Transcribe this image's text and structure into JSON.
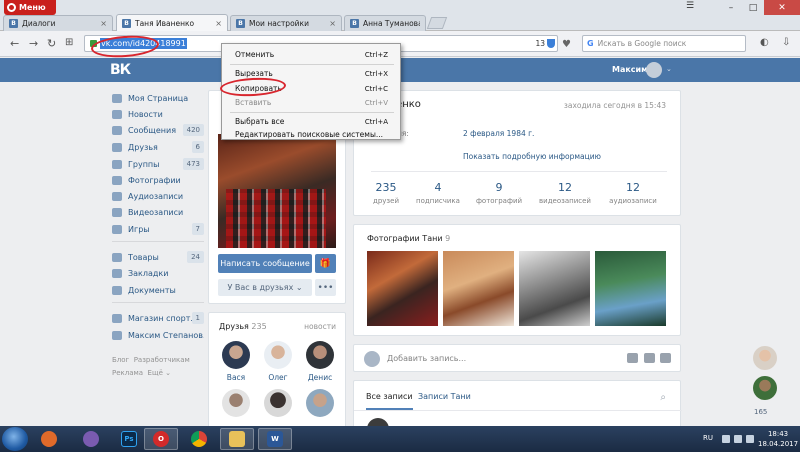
{
  "browser": {
    "menu_label": "Меню",
    "tabs": [
      {
        "title": "Диалоги",
        "active": false
      },
      {
        "title": "Таня Иваненко",
        "active": true
      },
      {
        "title": "Мои настройки",
        "active": false
      },
      {
        "title": "Анна Туманова",
        "active": false
      }
    ],
    "url": "vk.com/id420418991",
    "url_counter": "13",
    "search_placeholder": "Искать в Google поиск"
  },
  "header": {
    "logo": "ВК",
    "user_name": "Максим"
  },
  "sidebar": {
    "items": [
      {
        "label": "Моя Страница",
        "badge": ""
      },
      {
        "label": "Новости",
        "badge": ""
      },
      {
        "label": "Сообщения",
        "badge": "420"
      },
      {
        "label": "Друзья",
        "badge": "6"
      },
      {
        "label": "Группы",
        "badge": "473"
      },
      {
        "label": "Фотографии",
        "badge": ""
      },
      {
        "label": "Аудиозаписи",
        "badge": ""
      },
      {
        "label": "Видеозаписи",
        "badge": ""
      },
      {
        "label": "Игры",
        "badge": "7"
      },
      {
        "label": "Товары",
        "badge": "24"
      },
      {
        "label": "Закладки",
        "badge": ""
      },
      {
        "label": "Документы",
        "badge": ""
      },
      {
        "label": "Магазин спорт...",
        "badge": "1"
      },
      {
        "label": "Максим Степанов...",
        "badge": ""
      }
    ],
    "footer": {
      "blog": "Блог",
      "developers": "Разработчикам",
      "ads": "Реклама",
      "more": "Ещё ⌄"
    }
  },
  "profile": {
    "name": "иваненко",
    "last_seen": "заходила сегодня в 15:43",
    "birthday_label": "ождения:",
    "birthday": "2 февраля 1984 г.",
    "more_info": "Показать подробную информацию",
    "stats": [
      {
        "n": "235",
        "label": "друзей"
      },
      {
        "n": "4",
        "label": "подписчика"
      },
      {
        "n": "9",
        "label": "фотографий"
      },
      {
        "n": "12",
        "label": "видеозаписей"
      },
      {
        "n": "12",
        "label": "аудиозаписи"
      }
    ],
    "message_button": "Написать сообщение",
    "friends_button": "У Вас в друзьях ⌄",
    "more_button": "•••"
  },
  "friends": {
    "title": "Друзья",
    "count": "235",
    "all": "новости",
    "people": [
      "Вася",
      "Олег",
      "Денис"
    ]
  },
  "photos": {
    "title": "Фотографии Тани",
    "count": "9"
  },
  "post": {
    "placeholder": "Добавить запись..."
  },
  "wall": {
    "tab_all": "Все записи",
    "tab_user": "Записи Тани"
  },
  "chat": {
    "count": "165"
  },
  "context_menu": {
    "items": [
      {
        "label": "Отменить",
        "shortcut": "Ctrl+Z",
        "disabled": false
      },
      {
        "label": "Вырезать",
        "shortcut": "Ctrl+X",
        "disabled": false
      },
      {
        "label": "Копировать",
        "shortcut": "Ctrl+C",
        "disabled": false
      },
      {
        "label": "Вставить",
        "shortcut": "Ctrl+V",
        "disabled": true
      },
      {
        "label": "Выбрать все",
        "shortcut": "Ctrl+A",
        "disabled": false
      },
      {
        "label": "Редактировать поисковые системы...",
        "shortcut": "",
        "disabled": false
      }
    ]
  },
  "taskbar": {
    "lang": "RU",
    "time": "18:43",
    "date": "18.04.2017",
    "apps": [
      "Ps",
      "O",
      "W"
    ]
  },
  "colors": {
    "vk_blue": "#4a76a8",
    "link": "#2a5885",
    "annotation_red": "#d8262e"
  }
}
